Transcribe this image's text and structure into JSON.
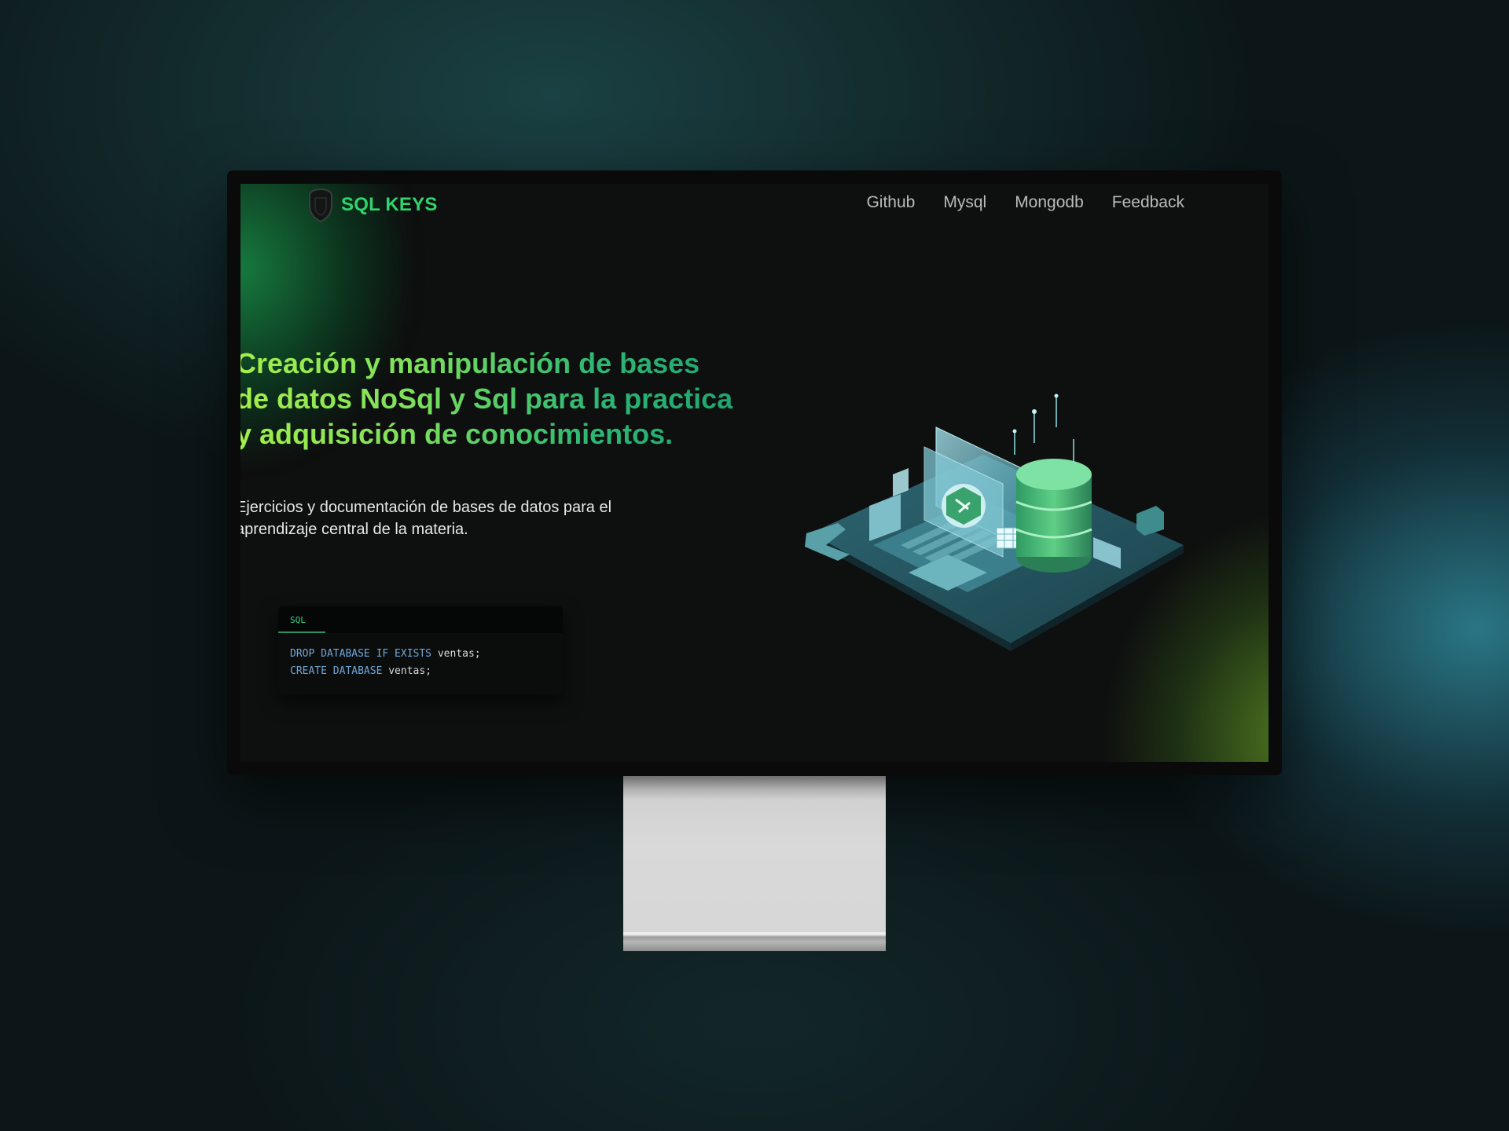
{
  "brand": {
    "name": "SQL KEYS"
  },
  "nav": {
    "items": [
      {
        "label": "Github"
      },
      {
        "label": "Mysql"
      },
      {
        "label": "Mongodb"
      },
      {
        "label": "Feedback"
      }
    ]
  },
  "hero": {
    "headline": "Creación y manipulación de bases de datos NoSql y Sql para la practica y adquisición de conocimientos.",
    "subtitle": "Ejercicios y documentación de bases de datos para el aprendizaje central de la materia."
  },
  "code_card": {
    "tab_label": "SQL",
    "lines": [
      {
        "keyword": "DROP DATABASE IF EXISTS",
        "rest": " ventas;"
      },
      {
        "keyword": "CREATE DATABASE",
        "rest": " ventas;"
      }
    ]
  },
  "colors": {
    "brand_green": "#2fd46c",
    "headline_gradient_start": "#a6f04a",
    "headline_gradient_end": "#1fa36f",
    "screen_background": "#0e0f0f",
    "code_keyword": "#6fa8d8"
  },
  "icons": {
    "logo": "shield-outline-icon",
    "illustration": "isometric-laptop-database-illustration"
  }
}
